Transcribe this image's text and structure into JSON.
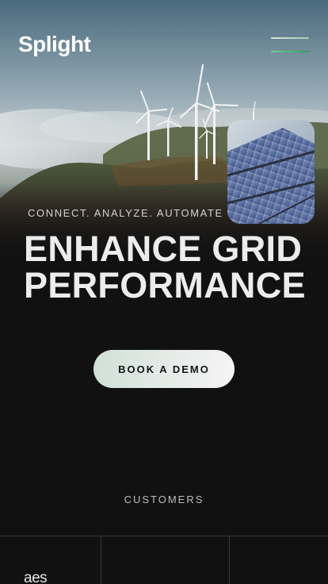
{
  "header": {
    "logo_text": "Splight",
    "menu_icon": "hamburger-menu-icon"
  },
  "hero": {
    "background_image": "wind turbines on misty hills",
    "inset_image": "solar panels",
    "tagline": "CONNECT. ANALYZE. AUTOMATE",
    "headline_line1": "ENHANCE GRID",
    "headline_line2": "PERFORMANCE",
    "cta_label": "BOOK A DEMO"
  },
  "customers": {
    "label": "CUSTOMERS",
    "logos": [
      "aes"
    ]
  },
  "colors": {
    "background": "#111111",
    "text_primary": "#ececec",
    "accent_green": "#4cbf7a",
    "cta_gradient_start": "#cfe0d8",
    "cta_gradient_end": "#f4f4f4"
  }
}
